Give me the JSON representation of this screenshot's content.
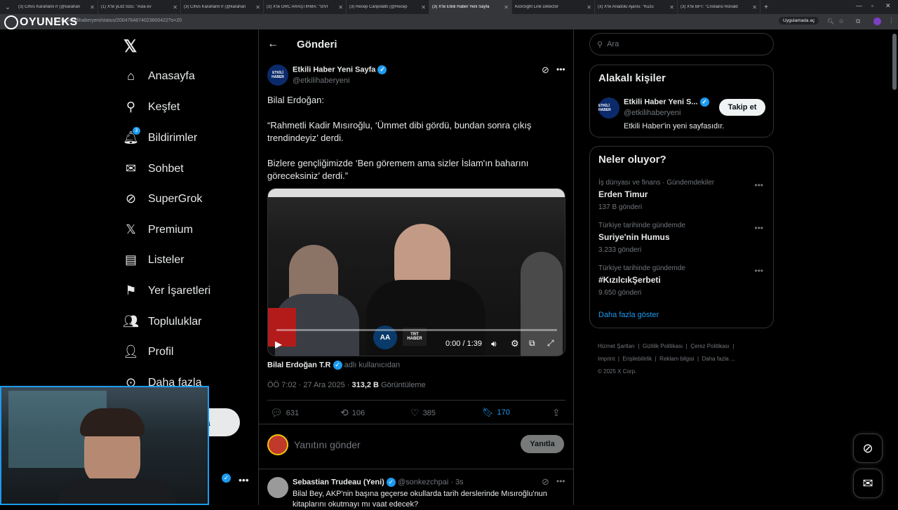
{
  "browser": {
    "tabs": [
      {
        "title": "(3) Cihvs Karahânli rr (@karahan"
      },
      {
        "title": "(1) X'te yLdz tozu: \"Asla ev"
      },
      {
        "title": "(3) Cihvs Karahânli rr (@karahan"
      },
      {
        "title": "(3) X'te ORC ARAŞTIRMA: \"SİVİ"
      },
      {
        "title": "(3) Recep Canpolattı (@Recep"
      },
      {
        "title": "(3) X'te Etkili Haber Yeni Sayfa"
      },
      {
        "title": "KickSight Link Detector"
      },
      {
        "title": "(3) X'te Anadolu Ajansı: \"Kuzu"
      },
      {
        "title": "(3) X'te BPT: \"Cristiano Ronald"
      }
    ],
    "url": "x.com/etkilihaberyeni/status/2004764874023600422?s=20",
    "app_chip": "Uygulamada aç"
  },
  "watermark": "OYUNEKS",
  "nav": {
    "items": [
      {
        "label": "Anasayfa",
        "icon": "home-icon"
      },
      {
        "label": "Keşfet",
        "icon": "search-icon"
      },
      {
        "label": "Bildirimler",
        "icon": "bell-icon",
        "badge": "3"
      },
      {
        "label": "Sohbet",
        "icon": "mail-icon"
      },
      {
        "label": "SuperGrok",
        "icon": "grok-icon"
      },
      {
        "label": "Premium",
        "icon": "x-icon"
      },
      {
        "label": "Listeler",
        "icon": "list-icon"
      },
      {
        "label": "Yer İşaretleri",
        "icon": "bookmark-icon"
      },
      {
        "label": "Topluluklar",
        "icon": "people-icon"
      },
      {
        "label": "Profil",
        "icon": "user-icon"
      },
      {
        "label": "Daha fazla",
        "icon": "more-icon"
      }
    ],
    "post_button_partial": "a"
  },
  "header": {
    "title": "Gönderi"
  },
  "post": {
    "author": "Etkili Haber Yeni Sayfa",
    "handle": "@etkilihaberyeni",
    "avatar_text": "ETKİLİ HABER",
    "lines": [
      "Bilal Erdoğan:",
      "“Rahmetli Kadir Mısıroğlu, ‘Ümmet dibi gördü, bundan sonra çıkış trendindeyiz’ derdi.",
      "Bizlere gençliğimizde ‘Ben göremem ama sizler İslam'ın baharını göreceksiniz’ derdi.”"
    ],
    "video": {
      "time": "0:00 / 1:39",
      "logo_trt": "TRT HABER",
      "logo_aa": "AA"
    },
    "credit_name": "Bilal Erdoğan T.R",
    "credit_suffix": "adlı kullanıcıdan",
    "timestamp": "ÖÖ 7:02 · 27 Ara 2025 ·",
    "views": "313,2 B",
    "views_label": "Görüntüleme",
    "stats": {
      "replies": "631",
      "reposts": "106",
      "likes": "385",
      "bookmarks": "170"
    }
  },
  "reply": {
    "placeholder": "Yanıtını gönder",
    "button": "Yanıtla"
  },
  "next_post": {
    "author": "Sebastian Trudeau (Yeni)",
    "handle": "@sonkezchpai",
    "time": "· 3s",
    "text": "Bilal Bey, AKP'nin başına geçerse okullarda tarih derslerinde Mısıroğlu'nun kitaplarını okutmayı mı vaat edecek?"
  },
  "right": {
    "search_placeholder": "Ara",
    "related_title": "Alakalı kişiler",
    "related": {
      "name": "Etkili Haber Yeni S...",
      "handle": "@etkilihaberyeni",
      "bio": "Etkili Haber'in yeni sayfasıdır.",
      "follow": "Takip et"
    },
    "trends_title": "Neler oluyor?",
    "trends": [
      {
        "meta": "İş dünyası ve finans · Gündemdekiler",
        "name": "Erden Timur",
        "count": "137 B gönderi"
      },
      {
        "meta": "Türkiye tarihinde gündemde",
        "name": "Suriye'nin Humus",
        "count": "3.233 gönderi"
      },
      {
        "meta": "Türkiye tarihinde gündemde",
        "name": "#KızılcıkŞerbeti",
        "count": "9.650 gönderi"
      }
    ],
    "show_more": "Daha fazla göster",
    "footer": [
      "Hizmet Şartları",
      "Gizlilik Politikası",
      "Çerez Politikası",
      "Imprint",
      "Erişilebilirlik",
      "Reklam bilgisi",
      "Daha fazla ...",
      "© 2025 X Corp."
    ]
  },
  "colors": {
    "accent": "#1d9bf0",
    "bg": "#000000",
    "border": "#2f3336",
    "muted": "#71767b"
  }
}
